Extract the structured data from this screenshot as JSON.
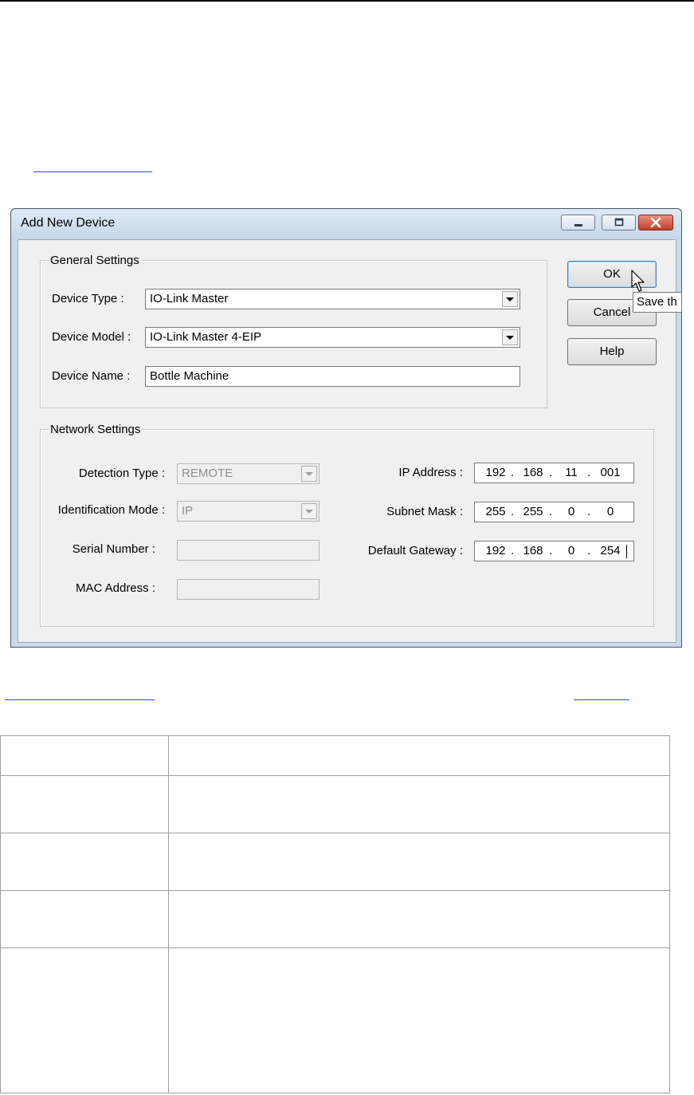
{
  "dialog": {
    "title": "Add New Device",
    "buttons": {
      "ok": "OK",
      "cancel": "Cancel",
      "help": "Help"
    },
    "tooltip": "Save th",
    "general": {
      "group_title": "General Settings",
      "device_type_label": "Device Type :",
      "device_type_value": "IO-Link Master",
      "device_model_label": "Device Model :",
      "device_model_value": "IO-Link Master 4-EIP",
      "device_name_label": "Device Name :",
      "device_name_value": "Bottle Machine"
    },
    "network": {
      "group_title": "Network Settings",
      "detection_type_label": "Detection Type :",
      "detection_type_value": "REMOTE",
      "identification_mode_label": "Identification Mode :",
      "identification_mode_value": "IP",
      "serial_number_label": "Serial Number :",
      "mac_address_label": "MAC Address :",
      "ip_address_label": "IP Address :",
      "ip_address": [
        "192",
        "168",
        "11",
        "001"
      ],
      "subnet_mask_label": "Subnet Mask :",
      "subnet_mask": [
        "255",
        "255",
        "0",
        "0"
      ],
      "default_gateway_label": "Default Gateway :",
      "default_gateway": [
        "192",
        "168",
        "0",
        "254"
      ]
    }
  },
  "icons": [
    "minimize-icon",
    "maximize-icon",
    "close-icon",
    "dropdown-arrow-icon",
    "mouse-cursor-icon"
  ],
  "colors": {
    "titlebar": "#c9daea",
    "close_button": "#c2402a",
    "link": "#2b4bd6",
    "window_bg": "#f0f0f0"
  }
}
